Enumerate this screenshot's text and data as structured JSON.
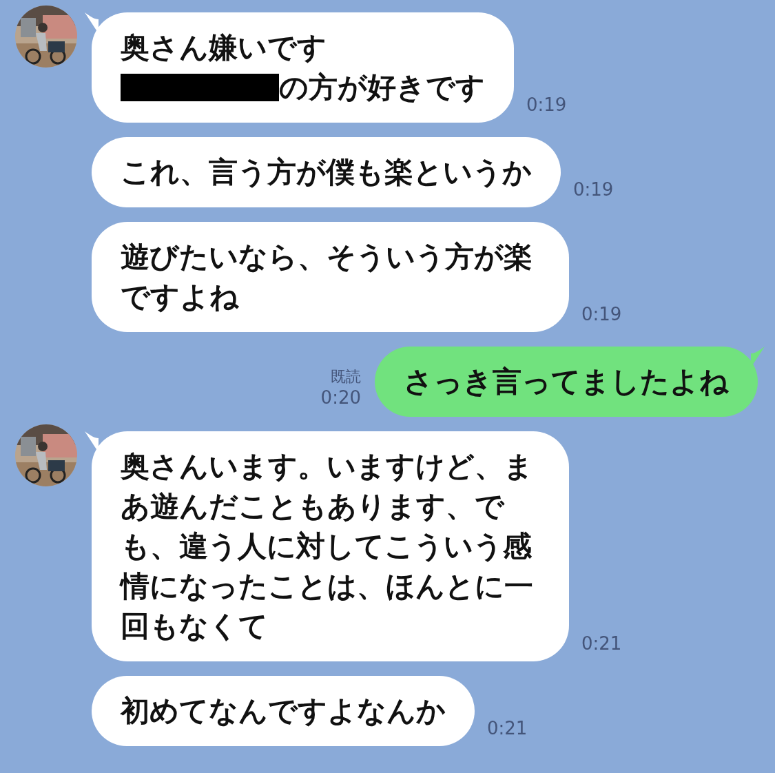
{
  "messages": [
    {
      "kind": "received",
      "avatar": true,
      "parts": [
        {
          "kind": "text",
          "text": "奥さん嫌いです"
        },
        {
          "kind": "break"
        },
        {
          "kind": "redaction"
        },
        {
          "kind": "text",
          "text": "の方が好きです"
        }
      ],
      "time": "0:19"
    },
    {
      "kind": "received",
      "avatar": false,
      "parts": [
        {
          "kind": "text",
          "text": "これ、言う方が僕も楽というか"
        }
      ],
      "time": "0:19"
    },
    {
      "kind": "received",
      "avatar": false,
      "parts": [
        {
          "kind": "text",
          "text": "遊びたいなら、そういう方が楽ですよね"
        }
      ],
      "time": "0:19"
    },
    {
      "kind": "sent",
      "read_label": "既読",
      "parts": [
        {
          "kind": "text",
          "text": "さっき言ってましたよね"
        }
      ],
      "time": "0:20"
    },
    {
      "kind": "received",
      "avatar": true,
      "parts": [
        {
          "kind": "text",
          "text": "奥さんいます。いますけど、まあ遊んだこともあります、でも、違う人に対してこういう感情になったことは、ほんとに一回もなくて"
        }
      ],
      "time": "0:21"
    },
    {
      "kind": "received",
      "avatar": false,
      "parts": [
        {
          "kind": "text",
          "text": "初めてなんですよなんか"
        }
      ],
      "time": "0:21"
    }
  ]
}
